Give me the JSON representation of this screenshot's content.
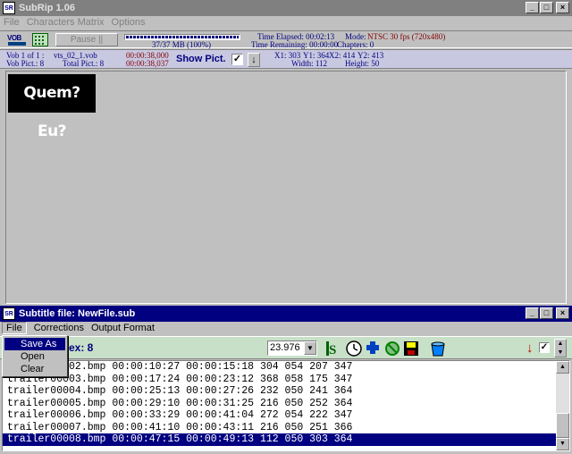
{
  "main_window": {
    "title": "SubRip 1.06",
    "menu": [
      "File",
      "Characters Matrix",
      "Options"
    ],
    "pause_label": "Pause ||",
    "progress_text": "37/37 MB (100%)",
    "progress_fraction": 1.0,
    "time_elapsed": "Time Elapsed: 00:02:13",
    "time_remaining": "Time Remaining: 00:00:00",
    "mode": "Mode:",
    "mode_value": "NTSC 30 fps (720x480)",
    "chapters": "Chapters: 0",
    "vob_count": "Vob 1 of 1 :",
    "vob_file": "vts_02_1.vob",
    "vob_pict": "Vob Pict.: 8",
    "total_pict": "Total Pict.: 8",
    "time_start": "00:00:38,000",
    "time_end": "00:00:38,037",
    "show_pict": "Show Pict.",
    "x1y1": "X1: 303",
    "y1": "Y1: 364",
    "x2": "X2: 414",
    "y2": "Y2: 413",
    "width": "Width: 112",
    "height": "Height: 50",
    "subtitle_text": "Quem? Eu?"
  },
  "subtitle_window": {
    "title": "Subtitle file: NewFile.sub",
    "menu": [
      "File",
      "Corrections",
      "Output Format"
    ],
    "index_label": "ex: 8",
    "fps": "23.976",
    "rows": [
      "trailer00002.bmp 00:00:10:27 00:00:15:18 304 054 207 347",
      "trailer00003.bmp 00:00:17:24 00:00:23:12 368 058 175 347",
      "trailer00004.bmp 00:00:25:13 00:00:27:26 232 050 241 364",
      "trailer00005.bmp 00:00:29:10 00:00:31:25 216 050 252 364",
      "trailer00006.bmp 00:00:33:29 00:00:41:04 272 054 222 347",
      "trailer00007.bmp 00:00:41:10 00:00:43:11 216 050 251 366",
      "trailer00008.bmp 00:00:47:15 00:00:49:13 112 050 303 364"
    ],
    "selected_row": 6
  },
  "file_menu": {
    "items": [
      "Save As",
      "Open",
      "Clear"
    ],
    "highlighted": 0
  },
  "colors": {
    "titlebar": "#808080",
    "active_titlebar": "#000080",
    "info_panel": "#c8c8e0",
    "toolbar_green": "#c8e0c8"
  },
  "icons": [
    "vob-icon",
    "matrix-icon",
    "timer-icon",
    "clock-icon",
    "puzzle-icon",
    "no-icon",
    "save-icon",
    "bucket-icon",
    "arrow-down-icon"
  ]
}
